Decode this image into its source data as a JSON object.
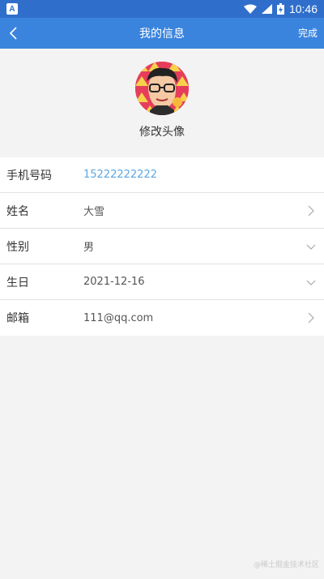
{
  "status_bar": {
    "app_icon_letter": "A",
    "time": "10:46"
  },
  "header": {
    "title": "我的信息",
    "done_label": "完成"
  },
  "profile": {
    "change_avatar_label": "修改头像"
  },
  "fields": [
    {
      "label": "手机号码",
      "value": "15222222222",
      "accessory": "none"
    },
    {
      "label": "姓名",
      "value": "大雪",
      "accessory": "chevron-right-icon"
    },
    {
      "label": "性别",
      "value": "男",
      "accessory": "chevron-down-icon"
    },
    {
      "label": "生日",
      "value": "2021-12-16",
      "accessory": "chevron-down-icon"
    },
    {
      "label": "邮箱",
      "value": "111@qq.com",
      "accessory": "chevron-right-icon"
    }
  ],
  "watermark": "@稀土掘金技术社区",
  "colors": {
    "status_bar": "#2f6fcb",
    "header": "#3a84dd",
    "phone_value": "#5aa7e6",
    "background": "#f3f3f3"
  }
}
